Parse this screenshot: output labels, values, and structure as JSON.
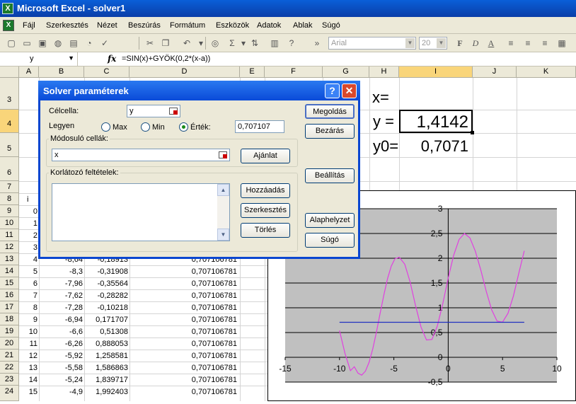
{
  "window": {
    "title": "Microsoft Excel - solver1"
  },
  "menu": [
    "Fájl",
    "Szerkesztés",
    "Nézet",
    "Beszúrás",
    "Formátum",
    "Eszközök",
    "Adatok",
    "Ablak",
    "Súgó"
  ],
  "toolbar": {
    "font_name": "Arial",
    "font_size": "20"
  },
  "formula_bar": {
    "name_box": "y",
    "fx_label": "fx",
    "formula": "=SIN(x)+GYÖK(0,2*(x-a))"
  },
  "columns": [
    "A",
    "B",
    "C",
    "D",
    "E",
    "F",
    "G",
    "H",
    "I",
    "J",
    "K"
  ],
  "rows": [
    "3",
    "4",
    "5",
    "6",
    "7",
    "8",
    "9",
    "10",
    "11",
    "12",
    "13",
    "14",
    "15",
    "16",
    "17",
    "18",
    "19",
    "20",
    "21",
    "22",
    "23",
    "24"
  ],
  "sheet": {
    "h3": "x=",
    "h4": "y =",
    "i4": "1,4142",
    "h5": "y0=",
    "i5": "0,7071",
    "a8": "i",
    "table": [
      {
        "a": "0",
        "b": "",
        "c": "",
        "d": ""
      },
      {
        "a": "1",
        "b": "",
        "c": "",
        "d": ""
      },
      {
        "a": "2",
        "b": "",
        "c": "",
        "d": ""
      },
      {
        "a": "3",
        "b": "",
        "c": "",
        "d": ""
      },
      {
        "a": "4",
        "b": "-8,64",
        "c": "-0,18913",
        "d": "0,707106781"
      },
      {
        "a": "5",
        "b": "-8,3",
        "c": "-0,31908",
        "d": "0,707106781"
      },
      {
        "a": "6",
        "b": "-7,96",
        "c": "-0,35564",
        "d": "0,707106781"
      },
      {
        "a": "7",
        "b": "-7,62",
        "c": "-0,28282",
        "d": "0,707106781"
      },
      {
        "a": "8",
        "b": "-7,28",
        "c": "-0,10218",
        "d": "0,707106781"
      },
      {
        "a": "9",
        "b": "-6,94",
        "c": "0,171707",
        "d": "0,707106781"
      },
      {
        "a": "10",
        "b": "-6,6",
        "c": "0,51308",
        "d": "0,707106781"
      },
      {
        "a": "11",
        "b": "-6,26",
        "c": "0,888053",
        "d": "0,707106781"
      },
      {
        "a": "12",
        "b": "-5,92",
        "c": "1,258581",
        "d": "0,707106781"
      },
      {
        "a": "13",
        "b": "-5,58",
        "c": "1,586863",
        "d": "0,707106781"
      },
      {
        "a": "14",
        "b": "-5,24",
        "c": "1,839717",
        "d": "0,707106781"
      },
      {
        "a": "15",
        "b": "-4,9",
        "c": "1,992403",
        "d": "0,707106781"
      }
    ]
  },
  "dialog": {
    "title": "Solver paraméterek",
    "help_glyph": "?",
    "close_glyph": "✕",
    "target_label": "Célcella:",
    "target_value": "y",
    "equal_label": "Legyen",
    "opt_max": "Max",
    "opt_min": "Min",
    "opt_value": "Érték:",
    "value": "0,707107",
    "changing_label": "Módosuló cellák:",
    "changing_value": "x",
    "guess_button": "Ajánlat",
    "constraints_label": "Korlátozó feltételek:",
    "add_button": "Hozzáadás",
    "change_button": "Szerkesztés",
    "delete_button": "Törlés",
    "solve_button": "Megoldás",
    "close_button": "Bezárás",
    "options_button": "Beállítás",
    "reset_button": "Alaphelyzet",
    "help_button": "Súgó"
  },
  "colors": {
    "curve": "#e040e0",
    "baseline": "#2030c0",
    "plot_bg": "#c0c0c0",
    "title_bar": "#0a4ad8"
  },
  "chart_data": {
    "type": "line",
    "xlim": [
      -15,
      10
    ],
    "ylim": [
      -0.5,
      3
    ],
    "x_ticks": [
      "-15",
      "-10",
      "-5",
      "0",
      "5",
      "10"
    ],
    "y_ticks": [
      "-0,5",
      "0",
      "0,5",
      "1",
      "1,5",
      "2",
      "2,5",
      "3"
    ],
    "series": [
      {
        "x": [
          -10,
          -9.5,
          -9,
          -8.64,
          -8.3,
          -7.96,
          -7.62,
          -7.28,
          -6.94,
          -6.6,
          -6.26,
          -5.92,
          -5.58,
          -5.24,
          -4.9,
          -4.5,
          -4,
          -3.5,
          -3,
          -2.5,
          -2,
          -1.5,
          -1,
          -0.5,
          0,
          0.5,
          1,
          1.5,
          2,
          2.5,
          3,
          3.5,
          4,
          4.5,
          5,
          5.5,
          6,
          6.5,
          7
        ],
        "y": [
          0.54,
          0.08,
          -0.27,
          -0.19,
          -0.32,
          -0.36,
          -0.28,
          -0.1,
          0.17,
          0.51,
          0.89,
          1.26,
          1.59,
          1.84,
          1.99,
          2.02,
          1.88,
          1.52,
          1.04,
          0.61,
          0.35,
          0.36,
          0.63,
          1.08,
          1.6,
          2.06,
          2.38,
          2.5,
          2.41,
          2.14,
          1.76,
          1.33,
          0.96,
          0.73,
          0.71,
          0.89,
          1.24,
          1.7,
          2.15
        ]
      },
      {
        "x": [
          -10,
          7
        ],
        "y": [
          0.7071,
          0.7071
        ]
      }
    ]
  }
}
